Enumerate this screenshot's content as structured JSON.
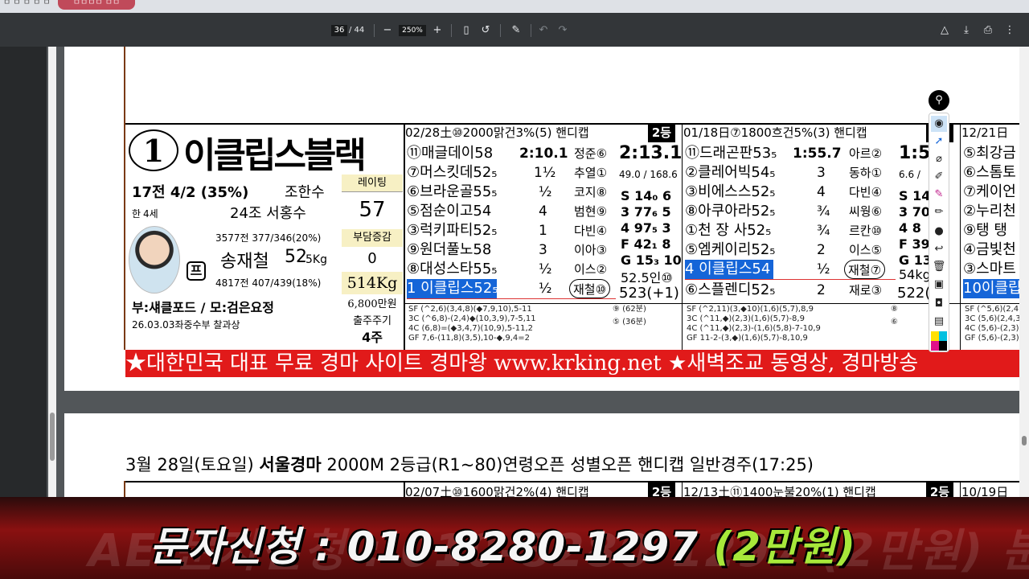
{
  "browser": {
    "tab_inactive": "ㅁ ㅁ ㅁ ㅁ ㅁ",
    "tab_active": "ㅁㅁㅁㅁ ㅁㅁ"
  },
  "toolbar": {
    "page_current": "36",
    "page_total": "/ 44",
    "zoom": "250%",
    "icons": [
      "minus-icon",
      "plus-icon",
      "fit-page-icon",
      "rotate-icon",
      "annotate-icon",
      "undo-icon",
      "redo-icon",
      "drive-icon",
      "download-icon",
      "print-icon",
      "more-icon"
    ]
  },
  "horse1": {
    "number": "1",
    "name": "이클립스블랙",
    "record": "17전 4/2 (35%)",
    "trainer_label": "조한수",
    "origin": "한",
    "age": "4세",
    "group_owner": "24조  서홍수",
    "trainer_record": "3577전 377/346(20%)",
    "jockey": "송재철",
    "jockey_weight_main": "52",
    "jockey_weight_sub": "5Kg",
    "jockey_record": "4817전 407/439(18%)",
    "pu_badge": "프",
    "rating_label": "레이팅",
    "rating": "57",
    "burden_label": "부담증감",
    "burden": "0",
    "body_weight": "514Kg",
    "price": "6,800만원",
    "cycle_label": "출주주기",
    "cycle": "4주",
    "pedigree": "부:섀클포드 / 모:검은요정",
    "vet_note": "26.03.03좌중수부 찰과상"
  },
  "race1": {
    "header": "02/28土⑩2000맑건3%(5) 핸디캡",
    "grade": "2등",
    "entries": [
      {
        "text": "⑪매글데이58",
        "margin": "2:10.1",
        "jockey": "정준⑥"
      },
      {
        "text": "⑦머스킷데52₅",
        "margin": "1½",
        "jockey": "추열①"
      },
      {
        "text": "⑥브라운골55₅",
        "margin": "½",
        "jockey": "코지⑧"
      },
      {
        "text": "⑤점순이고54",
        "margin": "4",
        "jockey": "범현⑨"
      },
      {
        "text": "③럭키파티52₅",
        "margin": "1",
        "jockey": "다빈④"
      },
      {
        "text": "⑨원더풀노58",
        "margin": "3",
        "jockey": "이아③"
      },
      {
        "text": "⑧대성스타55₅",
        "margin": "½",
        "jockey": "이스②"
      },
      {
        "text": "1 이클립스52₅",
        "margin": "½",
        "jockey": "재철⑩"
      }
    ],
    "time": "2:13.1",
    "sub_time": "49.0 / 168.6",
    "stats": [
      "S 14₀ 6",
      "3 77₆ 5",
      "4 97₅ 3",
      "F 42₁ 8",
      "G 15₃ 10"
    ],
    "weight_note": "52.5인⑩",
    "body_note": "523(+1)",
    "sf_lines": [
      "SF (^2,6)(3,4,8)(◆7,9,10),5-11",
      "3C (^6,8)-(2,4)◆(10,3,9),7-5,11",
      "4C (6,8)=(◆3,4,7)(10,9),5-11,2",
      "GF 7,6-(11,8)(3,5),10-◆,9,4=2"
    ],
    "sf_right": [
      "⑨ (62분)",
      "⑤ (36분)"
    ]
  },
  "race2": {
    "header": "01/18日⑦1800흐건5%(3) 핸디캡",
    "grade": "2등",
    "entries": [
      {
        "text": "⑪드래곤판53₅",
        "margin": "1:55.7",
        "jockey": "아르②"
      },
      {
        "text": "②클레어빅54₅",
        "margin": "3",
        "jockey": "동하①"
      },
      {
        "text": "③비에스스52₅",
        "margin": "4",
        "jockey": "다빈④"
      },
      {
        "text": "⑧아쿠아라52₅",
        "margin": "¾",
        "jockey": "씨웡⑥"
      },
      {
        "text": "①천 장 사52₅",
        "margin": "¾",
        "jockey": "르칸⑩"
      },
      {
        "text": "⑤엠케이리52₅",
        "margin": "2",
        "jockey": "이스⑤"
      },
      {
        "text": "4 이클립스54",
        "margin": "½",
        "jockey": "재철⑦"
      },
      {
        "text": "⑥스플렌디52₅",
        "margin": "2",
        "jockey": "재로③"
      }
    ],
    "time": "1:5",
    "sub_time": "6.6 /",
    "stats": [
      "S 14",
      "3 70",
      "4 8",
      "F 39",
      "G 13"
    ],
    "weight_note": "54kg",
    "body_note": "522(",
    "sf_lines": [
      "SF (^2,11)(3,◆10)(1,6)(5,7),8,9",
      "3C (^11,◆)(2,3)(1,6)(5,7)-8,9",
      "4C (^11,◆)(2,3)-(1,6)(5,8)-7-10,9",
      "GF 11-2-(3,◆)(1,6)(5,7)-8,10,9"
    ],
    "sf_right": [
      "⑧",
      "⑥"
    ]
  },
  "race3": {
    "header": "12/21日",
    "entries": [
      "⑤최강금",
      "⑥스톰토",
      "⑦케이언",
      "②누리천",
      "⑨탱 탱",
      "④금빛천",
      "③스마트",
      "10이클립"
    ],
    "sf_lines": [
      "SF (^5,6)(2,4),",
      "3C (5,6)(2,4,3",
      "4C (5,6)-(2,3)",
      "GF (5,6)-(2,3)"
    ]
  },
  "banner": "★대한민국 대표 무료 경마 사이트 경마왕 www.krking.net   ★새벽조교 동영상, 경마방송",
  "page2": {
    "race_title_pre": "3월 28일(토요일)  ",
    "race_title_bold": "서울경마",
    "race_title_post": "  2000M  2등급(R1~80)연령오픈 성별오픈  핸디캡  일반경주(17:25)",
    "race_a_header": "02/07土⑩1600맑건2%(4) 핸디캡",
    "race_a_grade": "2등",
    "race_b_header": "12/13土⑪1400눈불20%(1) 핸디캡",
    "race_b_grade": "2등",
    "race_c_header": "10/19日"
  },
  "promo": {
    "bg_text": "AE 문자신청 : 010-8280-1297 (2만원) 분전",
    "label": "문자신청 : 010-8280-1297",
    "price": "(2만원)"
  },
  "annotation_tools": [
    "pin-icon",
    "eye-icon",
    "pointer-icon",
    "eraser-icon",
    "marker-icon",
    "highlighter-icon",
    "pen-icon",
    "circle-dot-icon",
    "lasso-icon",
    "trash-icon",
    "shapes-icon",
    "camera-icon",
    "clipboard-icon",
    "palette-icon"
  ]
}
